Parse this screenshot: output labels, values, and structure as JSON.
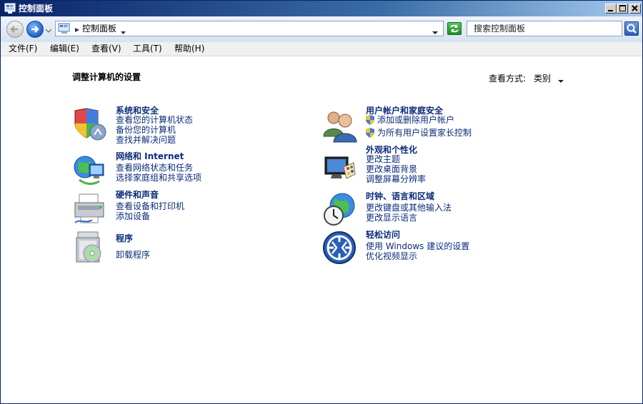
{
  "window": {
    "title": "控制面板"
  },
  "nav": {
    "breadcrumb": "控制面板",
    "search_placeholder": "搜索控制面板"
  },
  "menu": {
    "items": [
      "文件(F)",
      "编辑(E)",
      "查看(V)",
      "工具(T)",
      "帮助(H)"
    ]
  },
  "content": {
    "heading": "调整计算机的设置",
    "view_by_label": "查看方式:",
    "view_by_value": "类别"
  },
  "categories": [
    {
      "title": "系统和安全",
      "icon": "shield-computer-icon",
      "links": [
        "查看您的计算机状态",
        "备份您的计算机",
        "查找并解决问题"
      ]
    },
    {
      "title": "网络和 Internet",
      "icon": "network-globe-icon",
      "links": [
        "查看网络状态和任务",
        "选择家庭组和共享选项"
      ]
    },
    {
      "title": "硬件和声音",
      "icon": "printer-icon",
      "links": [
        "查看设备和打印机",
        "添加设备"
      ]
    },
    {
      "title": "程序",
      "icon": "programs-disc-icon",
      "links": [
        "卸载程序"
      ]
    },
    {
      "title": "用户帐户和家庭安全",
      "icon": "users-icon",
      "links": [
        "添加或删除用户帐户",
        "为所有用户设置家长控制"
      ]
    },
    {
      "title": "外观和个性化",
      "icon": "monitor-palette-icon",
      "links": [
        "更改主题",
        "更改桌面背景",
        "调整屏幕分辨率"
      ]
    },
    {
      "title": "时钟、语言和区域",
      "icon": "clock-globe-icon",
      "links": [
        "更改键盘或其他输入法",
        "更改显示语言"
      ]
    },
    {
      "title": "轻松访问",
      "icon": "ease-of-access-icon",
      "links": [
        "使用 Windows 建议的设置",
        "优化视频显示"
      ]
    }
  ]
}
